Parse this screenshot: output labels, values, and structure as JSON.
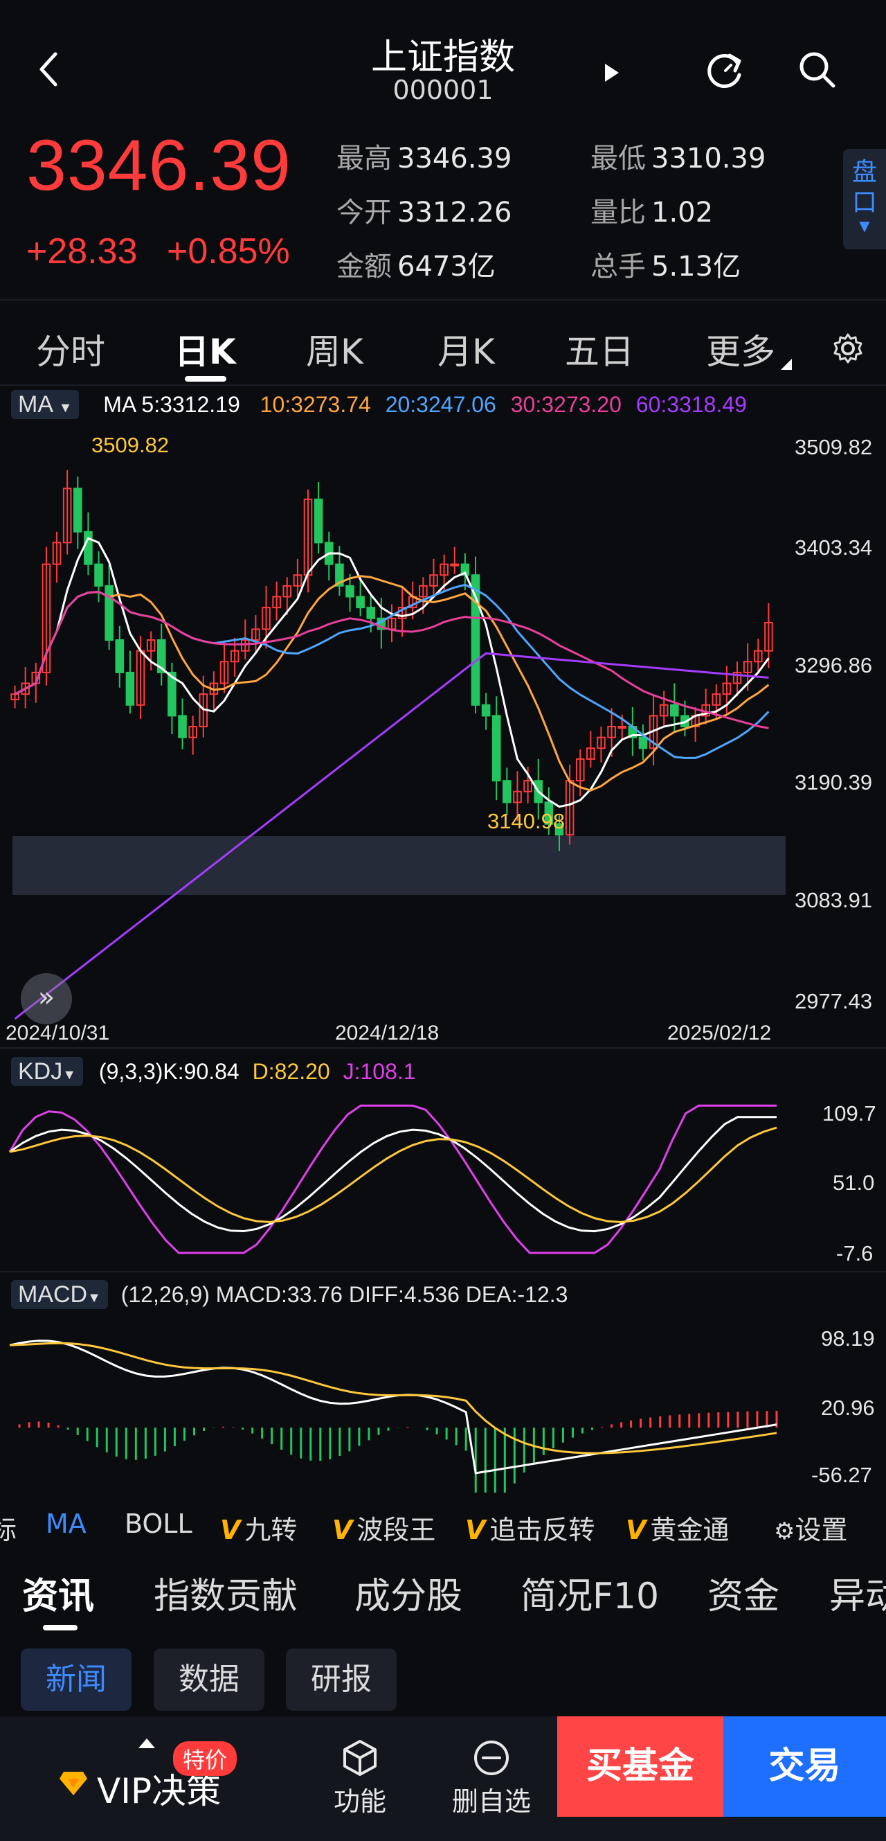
{
  "header": {
    "title": "上证指数",
    "code": "000001",
    "price": "3346.39",
    "change": "+28.33",
    "change_pct": "+0.85%",
    "stats": [
      {
        "k": "最高",
        "v": "3346.39"
      },
      {
        "k": "最低",
        "v": "3310.39"
      },
      {
        "k": "今开",
        "v": "3312.26"
      },
      {
        "k": "量比",
        "v": "1.02"
      },
      {
        "k": "金额",
        "v": "6473亿"
      },
      {
        "k": "总手",
        "v": "5.13亿"
      }
    ],
    "pankou": "盘口"
  },
  "tabs": [
    "分时",
    "日K",
    "周K",
    "月K",
    "五日",
    "更多"
  ],
  "ma_panel": {
    "tag": "MA",
    "ma5": "MA 5:3312.19",
    "ma10": "10:3273.74",
    "ma20": "20:3247.06",
    "ma30": "30:3273.20",
    "ma60": "60:3318.49",
    "high_label": "3509.82",
    "low_label": "3140.98",
    "y_ticks": [
      "3509.82",
      "3403.34",
      "3296.86",
      "3190.39",
      "3083.91",
      "2977.43"
    ],
    "dates": [
      "2024/10/31",
      "2024/12/18",
      "2025/02/12"
    ]
  },
  "kdj_panel": {
    "tag": "KDJ",
    "params": "(9,3,3)K:90.84",
    "d": "D:82.20",
    "j": "J:108.1",
    "y_ticks": [
      "109.7",
      "51.0",
      "-7.6"
    ]
  },
  "macd_panel": {
    "tag": "MACD",
    "text": "(12,26,9) MACD:33.76 DIFF:4.536 DEA:-12.3",
    "y_ticks": [
      "98.19",
      "20.96",
      "-56.27"
    ]
  },
  "indicators": {
    "first": "标",
    "ma": "MA",
    "boll": "BOLL",
    "v": "V",
    "jiuzhuan": "九转",
    "boduanwang": "波段王",
    "zhuiji": "追击反转",
    "huangjin": "黄金通",
    "settings": "设置"
  },
  "info_tabs": [
    "资讯",
    "指数贡献",
    "成分股",
    "简况F10",
    "资金",
    "异动"
  ],
  "chips": [
    "新闻",
    "数据",
    "研报"
  ],
  "bottom": {
    "vip": "VIP决策",
    "badge": "特价",
    "func": "功能",
    "del": "删自选",
    "buy": "买基金",
    "trade": "交易"
  },
  "colors": {
    "up": "#ff3b3b",
    "down": "#22c55e",
    "ma5": "#ffffff",
    "ma10": "#ffa640",
    "ma20": "#4ea6ff",
    "ma30": "#e8409a",
    "ma60": "#a63cff",
    "accent": "#3d8bff"
  },
  "chart_data": [
    {
      "type": "candlestick",
      "title": "日K",
      "x_range": [
        "2024/10/31",
        "2025/02/12"
      ],
      "ylim": [
        2977.43,
        3509.82
      ],
      "series": [
        {
          "name": "MA5",
          "last": 3312.19
        },
        {
          "name": "MA10",
          "last": 3273.74
        },
        {
          "name": "MA20",
          "last": 3247.06
        },
        {
          "name": "MA30",
          "last": 3273.2
        },
        {
          "name": "MA60",
          "last": 3318.49
        }
      ],
      "candles_close": [
        3280,
        3290,
        3300,
        3400,
        3420,
        3470,
        3430,
        3400,
        3380,
        3330,
        3300,
        3270,
        3320,
        3330,
        3300,
        3260,
        3240,
        3250,
        3280,
        3290,
        3310,
        3320,
        3330,
        3340,
        3360,
        3370,
        3380,
        3390,
        3460,
        3420,
        3400,
        3380,
        3370,
        3360,
        3350,
        3340,
        3350,
        3360,
        3370,
        3380,
        3390,
        3400,
        3400,
        3390,
        3270,
        3260,
        3200,
        3180,
        3190,
        3200,
        3180,
        3160,
        3150,
        3200,
        3220,
        3230,
        3240,
        3250,
        3250,
        3240,
        3230,
        3260,
        3270,
        3260,
        3250,
        3260,
        3270,
        3280,
        3290,
        3300,
        3310,
        3320,
        3346
      ]
    },
    {
      "type": "line",
      "title": "KDJ",
      "ylim": [
        -7.6,
        109.7
      ],
      "series": [
        {
          "name": "K",
          "last": 90.84
        },
        {
          "name": "D",
          "last": 82.2
        },
        {
          "name": "J",
          "last": 108.1
        }
      ]
    },
    {
      "type": "bar",
      "title": "MACD",
      "ylim": [
        -56.27,
        98.19
      ],
      "series": [
        {
          "name": "MACD",
          "last": 33.76
        },
        {
          "name": "DIFF",
          "last": 4.536
        },
        {
          "name": "DEA",
          "last": -12.3
        }
      ]
    }
  ]
}
